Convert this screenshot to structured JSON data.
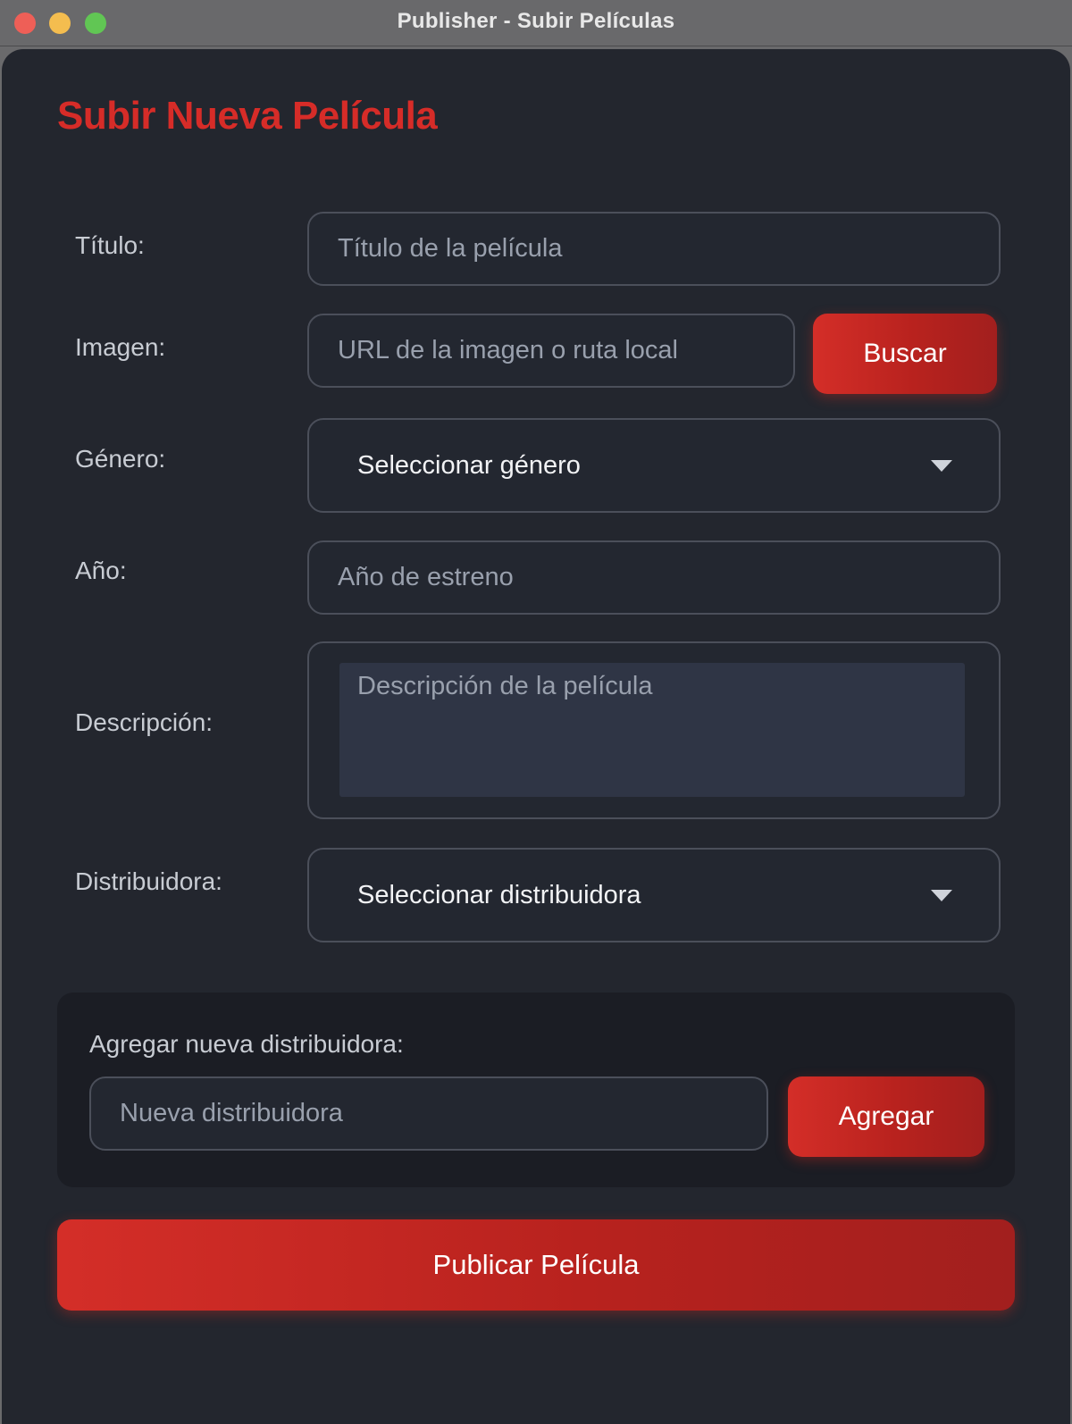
{
  "window": {
    "title": "Publisher - Subir Películas"
  },
  "heading": "Subir Nueva Película",
  "form": {
    "titulo": {
      "label": "Título:",
      "placeholder": "Título de la película"
    },
    "imagen": {
      "label": "Imagen:",
      "placeholder": "URL de la imagen o ruta local",
      "button": "Buscar"
    },
    "genero": {
      "label": "Género:",
      "selected": "Seleccionar género"
    },
    "anio": {
      "label": "Año:",
      "placeholder": "Año de estreno"
    },
    "descripcion": {
      "label": "Descripción:",
      "placeholder": "Descripción de la película"
    },
    "distribuidora": {
      "label": "Distribuidora:",
      "selected": "Seleccionar distribuidora"
    }
  },
  "new_distributor": {
    "label": "Agregar nueva distribuidora:",
    "placeholder": "Nueva distribuidora",
    "button": "Agregar"
  },
  "publish_button": "Publicar Película",
  "colors": {
    "accent": "#d62c28",
    "background": "#23262e",
    "panel": "#1b1d24",
    "titlebar": "#69696b"
  },
  "icons": [
    "close-traffic-light",
    "minimize-traffic-light",
    "maximize-traffic-light",
    "chevron-down-icon"
  ]
}
